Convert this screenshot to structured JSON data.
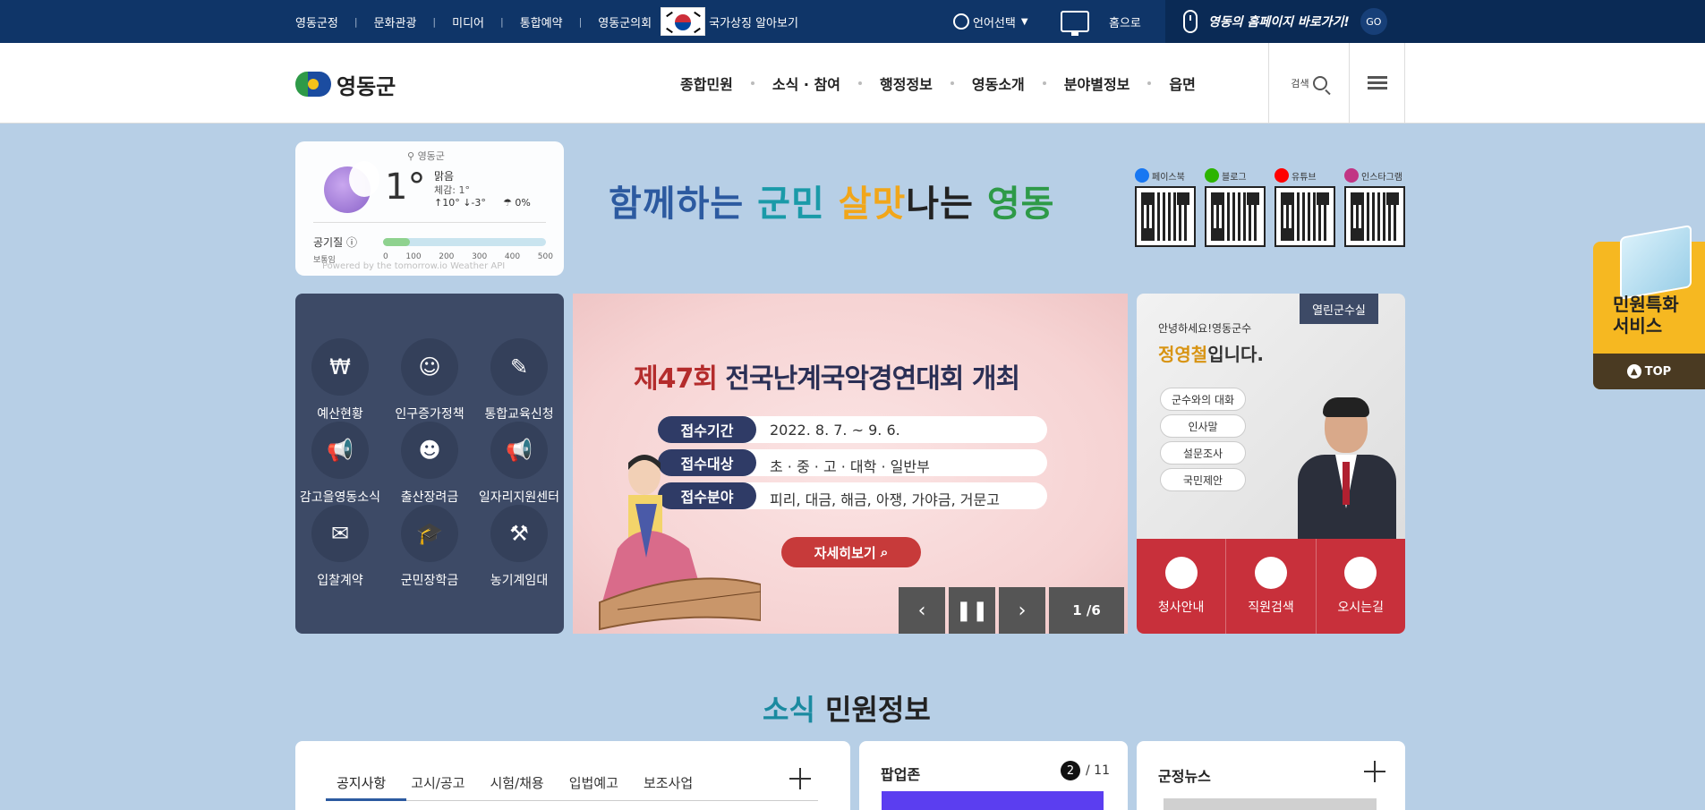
{
  "topbar": {
    "links": [
      "영동군정",
      "문화관광",
      "미디어",
      "통합예약",
      "영동군의회"
    ],
    "national_symbol_label": "국가상징 알아보기",
    "language_label": "언어선택",
    "home_label": "홈으로",
    "goto_label": "영동의 홈페이지 바로가기!",
    "go_label": "GO"
  },
  "header": {
    "logo_text": "영동군",
    "gnb": [
      "종합민원",
      "소식 · 참여",
      "행정정보",
      "영동소개",
      "분야별정보",
      "읍면"
    ],
    "search_label": "검색"
  },
  "weather": {
    "location": "영동군",
    "temperature": "1°",
    "condition": "맑음",
    "feels_like": "체감: 1°",
    "high": "↑10°",
    "low": "↓-3°",
    "rain": "0%",
    "air_quality_label": "공기질",
    "air_quality_status": "보통임",
    "air_quality_ticks": [
      "0",
      "100",
      "200",
      "300",
      "400",
      "500"
    ],
    "powered": "Powered by the tomorrow.io Weather API"
  },
  "slogan": {
    "part1": "함께하는",
    "part2": "군민",
    "part3": "살맛",
    "part4": "나는",
    "part5": "영동"
  },
  "sns": [
    {
      "label": "페이스북",
      "color": "#1877f2"
    },
    {
      "label": "블로그",
      "color": "#2db400"
    },
    {
      "label": "유튜브",
      "color": "#ff0000"
    },
    {
      "label": "인스타그램",
      "color": "#c13584"
    }
  ],
  "quick_menu": [
    {
      "label": "예산현황",
      "icon": "money-hand-icon",
      "glyph": "₩"
    },
    {
      "label": "인구증가정책",
      "icon": "people-icon",
      "glyph": "☺"
    },
    {
      "label": "통합교육신청",
      "icon": "pencil-icon",
      "glyph": "✎"
    },
    {
      "label": "감고을영동소식",
      "icon": "megaphone-icon",
      "glyph": "📢"
    },
    {
      "label": "출산장려금",
      "icon": "baby-icon",
      "glyph": "☻"
    },
    {
      "label": "일자리지원센터",
      "icon": "megaphone-icon",
      "glyph": "📢"
    },
    {
      "label": "입찰계약",
      "icon": "envelope-icon",
      "glyph": "✉"
    },
    {
      "label": "군민장학금",
      "icon": "graduation-cap-icon",
      "glyph": "🎓"
    },
    {
      "label": "농기계임대",
      "icon": "farm-tools-icon",
      "glyph": "⚒"
    }
  ],
  "banner": {
    "title_prefix": "제47회",
    "title_rest": "전국난계국악경연대회 개최",
    "rows": [
      {
        "key": "접수기간",
        "value": "2022. 8. 7. ~ 9. 6."
      },
      {
        "key": "접수대상",
        "value": "초 · 중 · 고 · 대학 · 일반부"
      },
      {
        "key": "접수분야",
        "value": "피리, 대금, 해금, 아쟁, 가야금, 거문고"
      }
    ],
    "button_label": "자세히보기",
    "pager": "1 /6"
  },
  "mayor": {
    "badge": "열린군수실",
    "greeting": "안녕하세요!영동군수",
    "name": "정영철",
    "name_suffix": "입니다.",
    "pills": [
      "군수와의 대화",
      "인사말",
      "설문조사",
      "국민제안"
    ],
    "bottom": [
      "청사안내",
      "직원검색",
      "오시는길"
    ]
  },
  "side_widget": {
    "title_line1": "민원특화",
    "title_line2": "서비스",
    "top_label": "TOP"
  },
  "section": {
    "title_highlight": "소식",
    "title_rest": " 민원정보"
  },
  "notice_card": {
    "tabs": [
      "공지사항",
      "고시/공고",
      "시험/채용",
      "입법예고",
      "보조사업"
    ]
  },
  "popup_card": {
    "title": "팝업존",
    "current": "2",
    "total": "/ 11"
  },
  "news_card": {
    "title": "군정뉴스"
  }
}
